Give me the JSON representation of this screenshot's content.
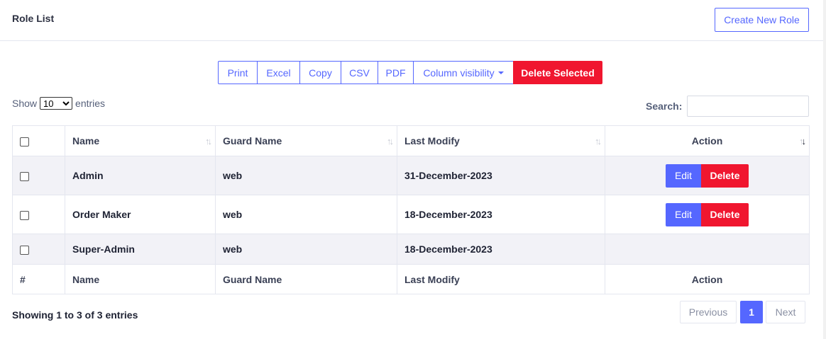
{
  "header": {
    "title": "Role List",
    "create_button": "Create New Role"
  },
  "toolbar": {
    "buttons": [
      "Print",
      "Excel",
      "Copy",
      "CSV",
      "PDF",
      "Column visibility"
    ],
    "delete_selected": "Delete Selected"
  },
  "length": {
    "show": "Show",
    "value": "10",
    "entries": "entries"
  },
  "search": {
    "label": "Search:",
    "value": ""
  },
  "table": {
    "headers": [
      "Name",
      "Guard Name",
      "Last Modify",
      "Action"
    ],
    "footers": [
      "#",
      "Name",
      "Guard Name",
      "Last Modify",
      "Action"
    ],
    "rows": [
      {
        "name": "Admin",
        "guard": "web",
        "modified": "31-December-2023",
        "edit": "Edit",
        "delete": "Delete"
      },
      {
        "name": "Order Maker",
        "guard": "web",
        "modified": "18-December-2023",
        "edit": "Edit",
        "delete": "Delete"
      },
      {
        "name": "Super-Admin",
        "guard": "web",
        "modified": "18-December-2023"
      }
    ]
  },
  "info": "Showing 1 to 3 of 3 entries",
  "pagination": {
    "previous": "Previous",
    "current": "1",
    "next": "Next"
  },
  "colors": {
    "primary": "#5567ff",
    "danger": "#f0162f",
    "row_stripe": "#f2f2f7"
  }
}
